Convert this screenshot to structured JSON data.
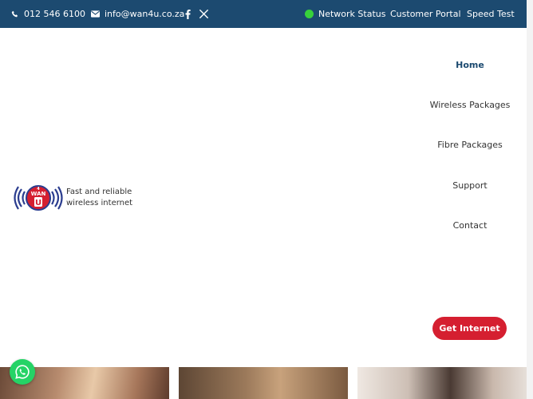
{
  "topbar": {
    "phone": "012 546 6100",
    "email": "info@wan4u.co.za",
    "network_status": "Network Status",
    "customer_portal": "Customer Portal",
    "speed_test": "Speed Test",
    "status_color": "#37d13b",
    "background": "#1c4a70"
  },
  "brand": {
    "logo_text": "WAN4U",
    "tagline_line1": "Fast and reliable",
    "tagline_line2": "wireless internet"
  },
  "nav": {
    "items": [
      {
        "label": "Home",
        "active": true
      },
      {
        "label": "Wireless Packages",
        "active": false
      },
      {
        "label": "Fibre Packages",
        "active": false
      },
      {
        "label": "Support",
        "active": false
      },
      {
        "label": "Contact",
        "active": false
      }
    ]
  },
  "cta": {
    "label": "Get Internet",
    "color": "#d51f30"
  },
  "icons": {
    "phone": "phone-icon",
    "email": "envelope-icon",
    "facebook": "facebook-icon",
    "x": "x-icon",
    "whatsapp": "whatsapp-icon"
  }
}
